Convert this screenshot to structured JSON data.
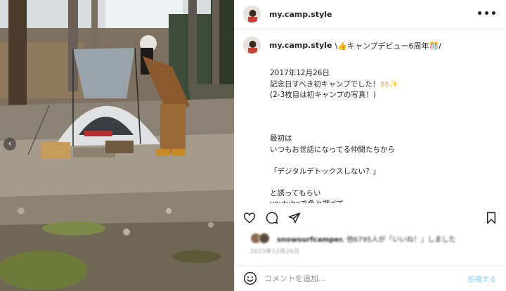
{
  "header": {
    "username": "my.camp.style",
    "more_label": "•••"
  },
  "caption": {
    "username": "my.camp.style",
    "title": "\\👍キャンプデビュー6周年🎊/",
    "body": "2017年12月26日\n記念日すべき初キャンプでした！🙌🏻✨\n(2-3枚目は初キャンプの写真！)\n\n\n\n最初は\nいつもお世話になってる仲間たちから\n\n「デジタルデトックスしない？」\n\nと誘ってもらい\nyoutubeで色々調べて"
  },
  "actions": {
    "icons": [
      "heart-icon",
      "comment-icon",
      "share-icon",
      "bookmark-icon"
    ]
  },
  "likes": {
    "username": "snowsurfcamper.",
    "text": "他6795人が「いいね！」しました"
  },
  "post_date": "2023年12月26日",
  "comment": {
    "placeholder": "コメントを追加...",
    "post_label": "投稿する"
  },
  "carousel": {
    "prev_label": "‹"
  },
  "colors": {
    "post_button": "#b2dffc",
    "divider": "#efefef",
    "muted_text": "#8e8e8e"
  }
}
